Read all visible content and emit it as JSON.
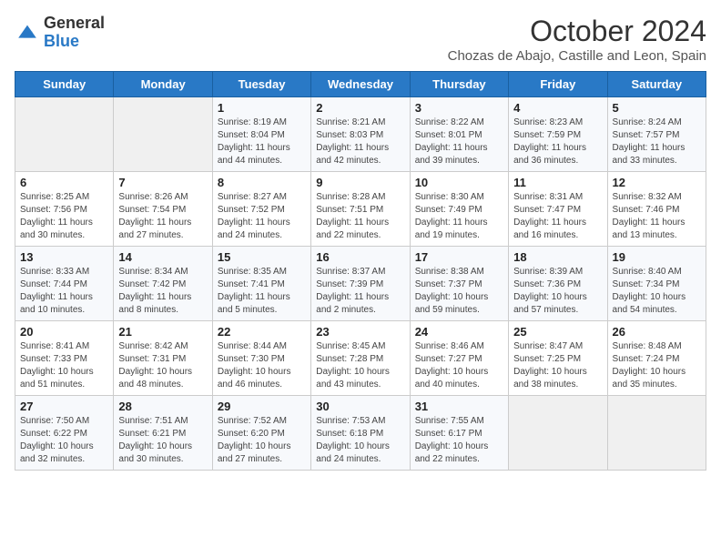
{
  "header": {
    "logo_general": "General",
    "logo_blue": "Blue",
    "month": "October 2024",
    "location": "Chozas de Abajo, Castille and Leon, Spain"
  },
  "days_of_week": [
    "Sunday",
    "Monday",
    "Tuesday",
    "Wednesday",
    "Thursday",
    "Friday",
    "Saturday"
  ],
  "weeks": [
    [
      {
        "day": "",
        "content": ""
      },
      {
        "day": "",
        "content": ""
      },
      {
        "day": "1",
        "content": "Sunrise: 8:19 AM\nSunset: 8:04 PM\nDaylight: 11 hours and 44 minutes."
      },
      {
        "day": "2",
        "content": "Sunrise: 8:21 AM\nSunset: 8:03 PM\nDaylight: 11 hours and 42 minutes."
      },
      {
        "day": "3",
        "content": "Sunrise: 8:22 AM\nSunset: 8:01 PM\nDaylight: 11 hours and 39 minutes."
      },
      {
        "day": "4",
        "content": "Sunrise: 8:23 AM\nSunset: 7:59 PM\nDaylight: 11 hours and 36 minutes."
      },
      {
        "day": "5",
        "content": "Sunrise: 8:24 AM\nSunset: 7:57 PM\nDaylight: 11 hours and 33 minutes."
      }
    ],
    [
      {
        "day": "6",
        "content": "Sunrise: 8:25 AM\nSunset: 7:56 PM\nDaylight: 11 hours and 30 minutes."
      },
      {
        "day": "7",
        "content": "Sunrise: 8:26 AM\nSunset: 7:54 PM\nDaylight: 11 hours and 27 minutes."
      },
      {
        "day": "8",
        "content": "Sunrise: 8:27 AM\nSunset: 7:52 PM\nDaylight: 11 hours and 24 minutes."
      },
      {
        "day": "9",
        "content": "Sunrise: 8:28 AM\nSunset: 7:51 PM\nDaylight: 11 hours and 22 minutes."
      },
      {
        "day": "10",
        "content": "Sunrise: 8:30 AM\nSunset: 7:49 PM\nDaylight: 11 hours and 19 minutes."
      },
      {
        "day": "11",
        "content": "Sunrise: 8:31 AM\nSunset: 7:47 PM\nDaylight: 11 hours and 16 minutes."
      },
      {
        "day": "12",
        "content": "Sunrise: 8:32 AM\nSunset: 7:46 PM\nDaylight: 11 hours and 13 minutes."
      }
    ],
    [
      {
        "day": "13",
        "content": "Sunrise: 8:33 AM\nSunset: 7:44 PM\nDaylight: 11 hours and 10 minutes."
      },
      {
        "day": "14",
        "content": "Sunrise: 8:34 AM\nSunset: 7:42 PM\nDaylight: 11 hours and 8 minutes."
      },
      {
        "day": "15",
        "content": "Sunrise: 8:35 AM\nSunset: 7:41 PM\nDaylight: 11 hours and 5 minutes."
      },
      {
        "day": "16",
        "content": "Sunrise: 8:37 AM\nSunset: 7:39 PM\nDaylight: 11 hours and 2 minutes."
      },
      {
        "day": "17",
        "content": "Sunrise: 8:38 AM\nSunset: 7:37 PM\nDaylight: 10 hours and 59 minutes."
      },
      {
        "day": "18",
        "content": "Sunrise: 8:39 AM\nSunset: 7:36 PM\nDaylight: 10 hours and 57 minutes."
      },
      {
        "day": "19",
        "content": "Sunrise: 8:40 AM\nSunset: 7:34 PM\nDaylight: 10 hours and 54 minutes."
      }
    ],
    [
      {
        "day": "20",
        "content": "Sunrise: 8:41 AM\nSunset: 7:33 PM\nDaylight: 10 hours and 51 minutes."
      },
      {
        "day": "21",
        "content": "Sunrise: 8:42 AM\nSunset: 7:31 PM\nDaylight: 10 hours and 48 minutes."
      },
      {
        "day": "22",
        "content": "Sunrise: 8:44 AM\nSunset: 7:30 PM\nDaylight: 10 hours and 46 minutes."
      },
      {
        "day": "23",
        "content": "Sunrise: 8:45 AM\nSunset: 7:28 PM\nDaylight: 10 hours and 43 minutes."
      },
      {
        "day": "24",
        "content": "Sunrise: 8:46 AM\nSunset: 7:27 PM\nDaylight: 10 hours and 40 minutes."
      },
      {
        "day": "25",
        "content": "Sunrise: 8:47 AM\nSunset: 7:25 PM\nDaylight: 10 hours and 38 minutes."
      },
      {
        "day": "26",
        "content": "Sunrise: 8:48 AM\nSunset: 7:24 PM\nDaylight: 10 hours and 35 minutes."
      }
    ],
    [
      {
        "day": "27",
        "content": "Sunrise: 7:50 AM\nSunset: 6:22 PM\nDaylight: 10 hours and 32 minutes."
      },
      {
        "day": "28",
        "content": "Sunrise: 7:51 AM\nSunset: 6:21 PM\nDaylight: 10 hours and 30 minutes."
      },
      {
        "day": "29",
        "content": "Sunrise: 7:52 AM\nSunset: 6:20 PM\nDaylight: 10 hours and 27 minutes."
      },
      {
        "day": "30",
        "content": "Sunrise: 7:53 AM\nSunset: 6:18 PM\nDaylight: 10 hours and 24 minutes."
      },
      {
        "day": "31",
        "content": "Sunrise: 7:55 AM\nSunset: 6:17 PM\nDaylight: 10 hours and 22 minutes."
      },
      {
        "day": "",
        "content": ""
      },
      {
        "day": "",
        "content": ""
      }
    ]
  ]
}
